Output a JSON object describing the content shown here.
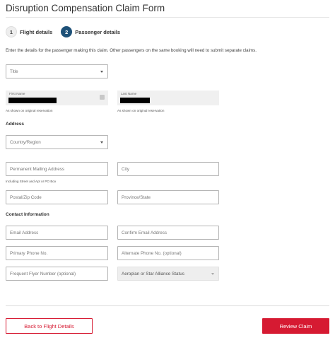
{
  "header": {
    "title": "Disruption Compensation Claim Form"
  },
  "steps": [
    {
      "number": "1",
      "label": "Flight details",
      "state": "inactive"
    },
    {
      "number": "2",
      "label": "Passenger details",
      "state": "active"
    }
  ],
  "intro": "Enter the details for the passenger making this claim. Other passengers on the same booking will need to submit separate claims.",
  "form": {
    "title_select": "Title",
    "first_name": {
      "label": "First Name",
      "value_redacted": true
    },
    "last_name": {
      "label": "Last Name",
      "value_redacted": true
    },
    "name_hint": "As shown on original reservation",
    "address_heading": "Address",
    "country_select": "Country/Region",
    "mailing_address": "Permanent Mailing Address",
    "city": "City",
    "mailing_hint": "Including Street and Apt or PO Box",
    "postal_code": "Postal/Zip Code",
    "province": "Province/State",
    "contact_heading": "Contact Information",
    "email": "Email Address",
    "confirm_email": "Confirm Email Address",
    "primary_phone": "Primary Phone No.",
    "alternate_phone": "Alternate Phone No. (optional)",
    "frequent_flyer": "Frequent Flyer Number (optional)",
    "alliance_status": "Aeroplan or Star Alliance Status"
  },
  "actions": {
    "back_label": "Back to Flight Details",
    "review_label": "Review Claim"
  },
  "colors": {
    "accent": "#d61a32",
    "step_active": "#1e5178"
  }
}
